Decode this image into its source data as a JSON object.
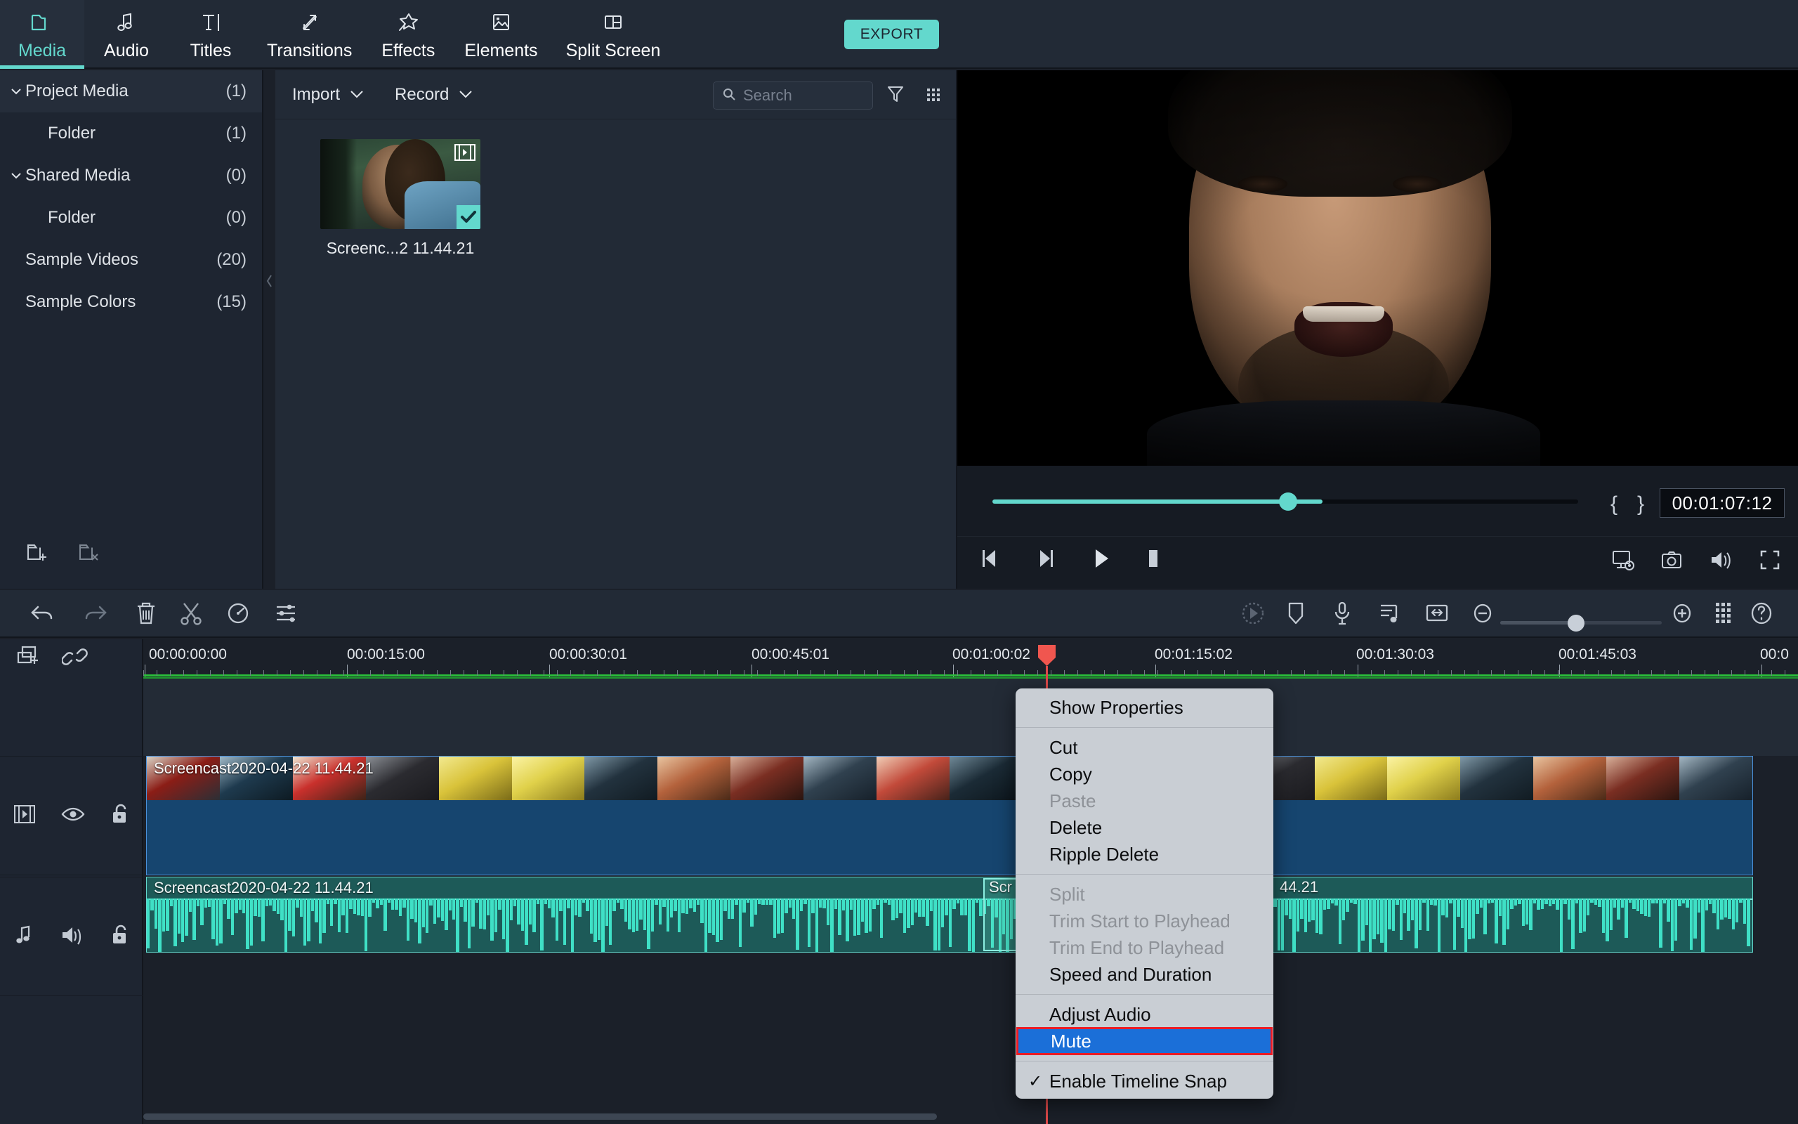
{
  "app": {
    "export_label": "EXPORT",
    "accent": "#63d8cd",
    "highlight_blue": "#1b6fd8",
    "highlight_outline": "#ec1c24"
  },
  "tabs": [
    {
      "label": "Media",
      "icon": "folder-icon",
      "active": true
    },
    {
      "label": "Audio",
      "icon": "music-note-icon",
      "active": false
    },
    {
      "label": "Titles",
      "icon": "text-icon",
      "active": false
    },
    {
      "label": "Transitions",
      "icon": "transitions-icon",
      "active": false
    },
    {
      "label": "Effects",
      "icon": "star-wand-icon",
      "active": false
    },
    {
      "label": "Elements",
      "icon": "image-icon",
      "active": false
    },
    {
      "label": "Split Screen",
      "icon": "split-screen-icon",
      "active": false
    }
  ],
  "sidebar": {
    "items": [
      {
        "label": "Project Media",
        "count": "(1)",
        "level": 0,
        "expandable": true,
        "selected": true
      },
      {
        "label": "Folder",
        "count": "(1)",
        "level": 1,
        "expandable": false,
        "selected": false
      },
      {
        "label": "Shared Media",
        "count": "(0)",
        "level": 0,
        "expandable": true,
        "selected": false
      },
      {
        "label": "Folder",
        "count": "(0)",
        "level": 1,
        "expandable": false,
        "selected": false
      },
      {
        "label": "Sample Videos",
        "count": "(20)",
        "level": 0,
        "expandable": false,
        "selected": false
      },
      {
        "label": "Sample Colors",
        "count": "(15)",
        "level": 0,
        "expandable": false,
        "selected": false
      }
    ],
    "footer": [
      {
        "icon": "add-folder-icon"
      },
      {
        "icon": "delete-folder-icon"
      }
    ]
  },
  "media_toolbar": {
    "import_label": "Import",
    "record_label": "Record",
    "search_placeholder": "Search",
    "search_value": "",
    "filter_icon": "filter-icon",
    "grid_icon": "grid-view-icon"
  },
  "media_items": [
    {
      "name": "Screenc...2 11.44.21",
      "selected": true,
      "badge": "video-clip-icon"
    }
  ],
  "preview": {
    "timecode": "00:01:07:12",
    "progress_percent": 56,
    "transport": [
      {
        "icon": "step-back-icon"
      },
      {
        "icon": "step-forward-icon"
      },
      {
        "icon": "play-icon"
      },
      {
        "icon": "stop-icon"
      }
    ],
    "right_tools": [
      {
        "icon": "screen-settings-icon"
      },
      {
        "icon": "snapshot-camera-icon"
      },
      {
        "icon": "volume-icon"
      },
      {
        "icon": "fullscreen-icon"
      }
    ],
    "mark_in_icon": "mark-in-icon",
    "mark_out_icon": "mark-out-icon"
  },
  "timeline_toolbar": {
    "left_tools": [
      {
        "icon": "undo-icon"
      },
      {
        "icon": "redo-icon"
      },
      {
        "icon": "delete-icon"
      },
      {
        "icon": "scissors-cut-icon"
      },
      {
        "icon": "speed-gauge-icon"
      },
      {
        "icon": "adjust-sliders-icon"
      }
    ],
    "right_tools": [
      {
        "icon": "render-preview-icon"
      },
      {
        "icon": "marker-icon"
      },
      {
        "icon": "microphone-icon"
      },
      {
        "icon": "audio-detach-icon"
      },
      {
        "icon": "fit-timeline-icon"
      },
      {
        "icon": "zoom-out-icon"
      },
      {
        "icon": "zoom-in-icon"
      },
      {
        "icon": "grid-dots-icon"
      },
      {
        "icon": "help-icon"
      }
    ],
    "zoom_percent": 42
  },
  "timeline": {
    "head_tools": [
      {
        "icon": "add-track-icon"
      },
      {
        "icon": "link-icon"
      }
    ],
    "ruler_labels": [
      "00:00:00:00",
      "00:00:15:00",
      "00:00:30:01",
      "00:00:45:01",
      "00:01:00:02",
      "00:01:15:02",
      "00:01:30:03",
      "00:01:45:03",
      "00:0"
    ],
    "playhead_timecode": "00:01:00:02",
    "tracks": [
      {
        "type": "video",
        "controls": [
          {
            "icon": "film-strip-icon"
          },
          {
            "icon": "eye-visible-icon"
          },
          {
            "icon": "unlock-icon"
          }
        ],
        "clip_label": "Screencast2020-04-22 11.44.21"
      },
      {
        "type": "audio",
        "controls": [
          {
            "icon": "music-note-icon"
          },
          {
            "icon": "speaker-on-icon"
          },
          {
            "icon": "unlock-icon"
          }
        ],
        "clip_label": "Screencast2020-04-22 11.44.21",
        "clip_label_2": "Scr",
        "clip_label_3": "44.21"
      }
    ]
  },
  "context_menu": {
    "groups": [
      {
        "items": [
          {
            "label": "Show Properties",
            "state": "enabled"
          }
        ]
      },
      {
        "items": [
          {
            "label": "Cut",
            "state": "enabled"
          },
          {
            "label": "Copy",
            "state": "enabled"
          },
          {
            "label": "Paste",
            "state": "disabled"
          },
          {
            "label": "Delete",
            "state": "enabled"
          },
          {
            "label": "Ripple Delete",
            "state": "enabled"
          }
        ]
      },
      {
        "items": [
          {
            "label": "Split",
            "state": "disabled"
          },
          {
            "label": "Trim Start to Playhead",
            "state": "disabled"
          },
          {
            "label": "Trim End to Playhead",
            "state": "disabled"
          },
          {
            "label": "Speed and Duration",
            "state": "enabled"
          }
        ]
      },
      {
        "items": [
          {
            "label": "Adjust Audio",
            "state": "enabled"
          },
          {
            "label": "Mute",
            "state": "highlight"
          }
        ]
      },
      {
        "items": [
          {
            "label": "Enable Timeline Snap",
            "state": "enabled",
            "checked": true
          }
        ]
      }
    ]
  }
}
